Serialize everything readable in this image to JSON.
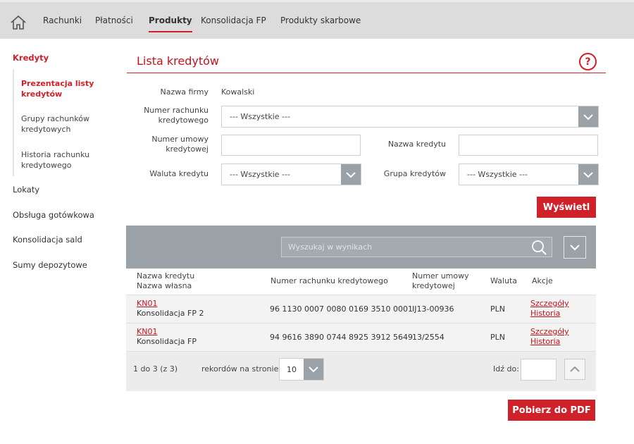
{
  "nav": {
    "home_icon": "home-icon",
    "items": [
      {
        "label": "Rachunki"
      },
      {
        "label": "Płatności"
      },
      {
        "label": "Produkty"
      },
      {
        "label": "Konsolidacja FP"
      },
      {
        "label": "Produkty skarbowe"
      }
    ],
    "active": "Produkty"
  },
  "sidebar": {
    "category": "Kredyty",
    "subitems": [
      "Prezentacja listy kredytów",
      "Grupy rachunków kredytowych",
      "Historia rachunku kredytowego"
    ],
    "items": [
      "Lokaty",
      "Obsługa gotówkowa",
      "Konsolidacja sald",
      "Sumy depozytowe"
    ]
  },
  "page": {
    "title": "Lista kredytów",
    "help_symbol": "?"
  },
  "form": {
    "company_label": "Nazwa firmy",
    "company_value": "Kowalski",
    "account_label": "Numer rachunku kredytowego",
    "account_value": "--- Wszystkie ---",
    "contract_label": "Numer umowy kredytowej",
    "contract_value": "",
    "credit_name_label": "Nazwa kredytu",
    "credit_name_value": "",
    "currency_label": "Waluta kredytu",
    "currency_value": "--- Wszystkie ---",
    "group_label": "Grupa kredytów",
    "group_value": "--- Wszystkie ---",
    "show_button": "Wyświetl"
  },
  "results": {
    "search_placeholder": "Wyszukaj w wynikach",
    "columns": {
      "name_line1": "Nazwa kredytu",
      "name_line2": "Nazwa własna",
      "account": "Numer rachunku kredytowego",
      "contract_line1": "Numer umowy",
      "contract_line2": "kredytowej",
      "currency": "Waluta",
      "actions": "Akcje"
    },
    "rows": [
      {
        "code": "KN01",
        "own_name": "Konsolidacja FP 2",
        "account": "96 1130 0007 0080 0169 3510 0001",
        "contract": "IJ13-00936",
        "currency": "PLN",
        "action1": "Szczegóły",
        "action2": "Historia"
      },
      {
        "code": "KN01",
        "own_name": "Konsolidacja FP",
        "account": "94 9616 3890 0744 8925 3912 5649",
        "contract": "13/2554",
        "currency": "PLN",
        "action1": "Szczegóły",
        "action2": "Historia"
      }
    ],
    "pagination": {
      "range": "1 do 3 (z 3)",
      "per_page_label": "rekordów na stronie",
      "per_page_value": "10",
      "goto_label": "Idź do:",
      "goto_value": ""
    },
    "pdf_button": "Pobierz do PDF"
  },
  "colors": {
    "accent": "#d0202a",
    "gray_bar": "#9aa1a7",
    "topbar": "#dcdcdc"
  }
}
